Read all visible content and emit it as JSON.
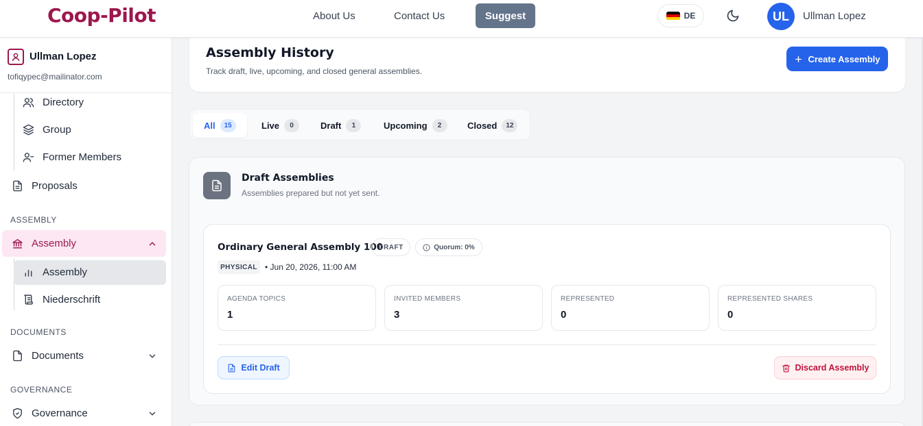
{
  "brand": "Coop-Pilot",
  "nav": {
    "about": "About Us",
    "contact": "Contact Us",
    "suggest": "Suggest"
  },
  "language": {
    "code": "DE",
    "flag_icon": "germany-flag-icon",
    "flag_colors": [
      "#000000",
      "#dd0000",
      "#ffce00"
    ]
  },
  "theme_icon": "moon-icon",
  "user": {
    "initials": "UL",
    "name": "Ullman Lopez",
    "email": "tofiqypec@mailinator.com"
  },
  "sidebar": {
    "members_sub": [
      {
        "label": "Directory",
        "icon": "users-icon"
      },
      {
        "label": "Group",
        "icon": "layers-icon"
      },
      {
        "label": "Former Members",
        "icon": "user-minus-icon"
      }
    ],
    "proposals": "Proposals",
    "sections": {
      "assembly": "ASSEMBLY",
      "documents": "DOCUMENTS",
      "governance": "GOVERNANCE"
    },
    "assembly": {
      "label": "Assembly",
      "icon": "bank-icon",
      "expanded": true
    },
    "assembly_sub": [
      {
        "label": "Assembly",
        "icon": "bar-chart-icon",
        "active": true
      },
      {
        "label": "Niederschrift",
        "icon": "scroll-icon"
      }
    ],
    "documents": "Documents",
    "governance": "Governance"
  },
  "page": {
    "title": "Assembly History",
    "subtitle": "Track draft, live, upcoming, and closed general assemblies.",
    "create_label": "Create Assembly"
  },
  "tabs": [
    {
      "label": "All",
      "count": "15",
      "active": true
    },
    {
      "label": "Live",
      "count": "0"
    },
    {
      "label": "Draft",
      "count": "1"
    },
    {
      "label": "Upcoming",
      "count": "2"
    },
    {
      "label": "Closed",
      "count": "12"
    }
  ],
  "draft_section": {
    "title": "Draft Assemblies",
    "subtitle": "Assemblies prepared but not yet sent."
  },
  "assembly": {
    "title": "Ordinary General Assembly 100",
    "status": "DRAFT",
    "quorum": "Quorum: 0%",
    "type": "PHYSICAL",
    "date": "• Jun 20, 2026, 11:00 AM",
    "stats": [
      {
        "label": "AGENDA TOPICS",
        "value": "1"
      },
      {
        "label": "INVITED MEMBERS",
        "value": "3"
      },
      {
        "label": "REPRESENTED",
        "value": "0"
      },
      {
        "label": "REPRESENTED SHARES",
        "value": "0"
      }
    ],
    "edit_label": "Edit Draft",
    "discard_label": "Discard Assembly"
  },
  "colors": {
    "brand": "#9d174d",
    "primary": "#2563eb",
    "danger": "#be123c"
  }
}
